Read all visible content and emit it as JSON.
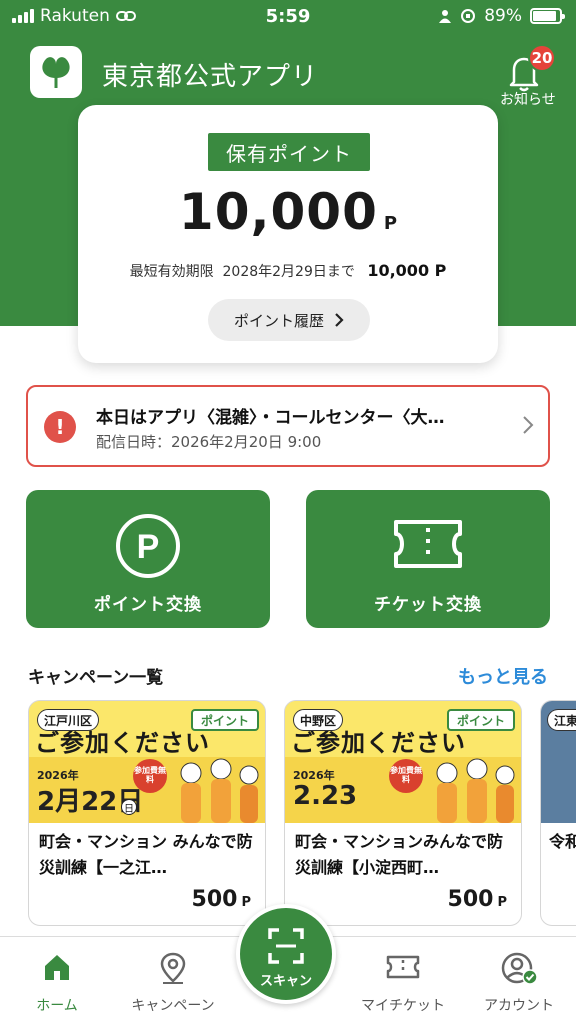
{
  "status_bar": {
    "carrier": "Rakuten",
    "time": "5:59",
    "battery": "89%",
    "battery_level": 0.89
  },
  "header": {
    "app_title": "東京都公式アプリ",
    "notifications_label": "お知らせ",
    "notifications_count": "20"
  },
  "points": {
    "tag": "保有ポイント",
    "value": "10,000",
    "unit": "P",
    "expiry_label": "最短有効期限",
    "expiry_date": "2028年2月29日まで",
    "expiry_amount": "10,000 P",
    "history_button": "ポイント履歴"
  },
  "notice": {
    "title": "本日はアプリ〈混雑〉・コールセンター〈大…",
    "date": "配信日時：2026年2月20日 9:00"
  },
  "actions": {
    "exchange_points": "ポイント交換",
    "exchange_tickets": "チケット交換"
  },
  "campaigns": {
    "title": "キャンペーン一覧",
    "see_more": "もっと見る",
    "items": [
      {
        "ward": "江戸川区",
        "tag": "ポイント",
        "headline": "ご参加ください",
        "year": "2026年",
        "date": "2月22日",
        "dow": "日",
        "seal": "参加費無料",
        "title": "町会・マンション みんなで防災訓練【一之江…",
        "price": "500",
        "unit": "P"
      },
      {
        "ward": "中野区",
        "tag": "ポイント",
        "headline": "ご参加ください",
        "year": "2026年",
        "date": "2.23",
        "dow": "",
        "seal": "参加費無料",
        "title": "町会・マンションみんなで防災訓練【小淀西町…",
        "price": "500",
        "unit": "P"
      },
      {
        "ward": "江東",
        "title": "令和ビン"
      }
    ]
  },
  "nav": {
    "home": "ホーム",
    "campaign": "キャンペーン",
    "scan": "スキャン",
    "my_tickets": "マイチケット",
    "account": "アカウント"
  },
  "colors": {
    "brand_green": "#3a8a40",
    "alert_red": "#e0524a",
    "link_blue": "#2d8bd9"
  }
}
